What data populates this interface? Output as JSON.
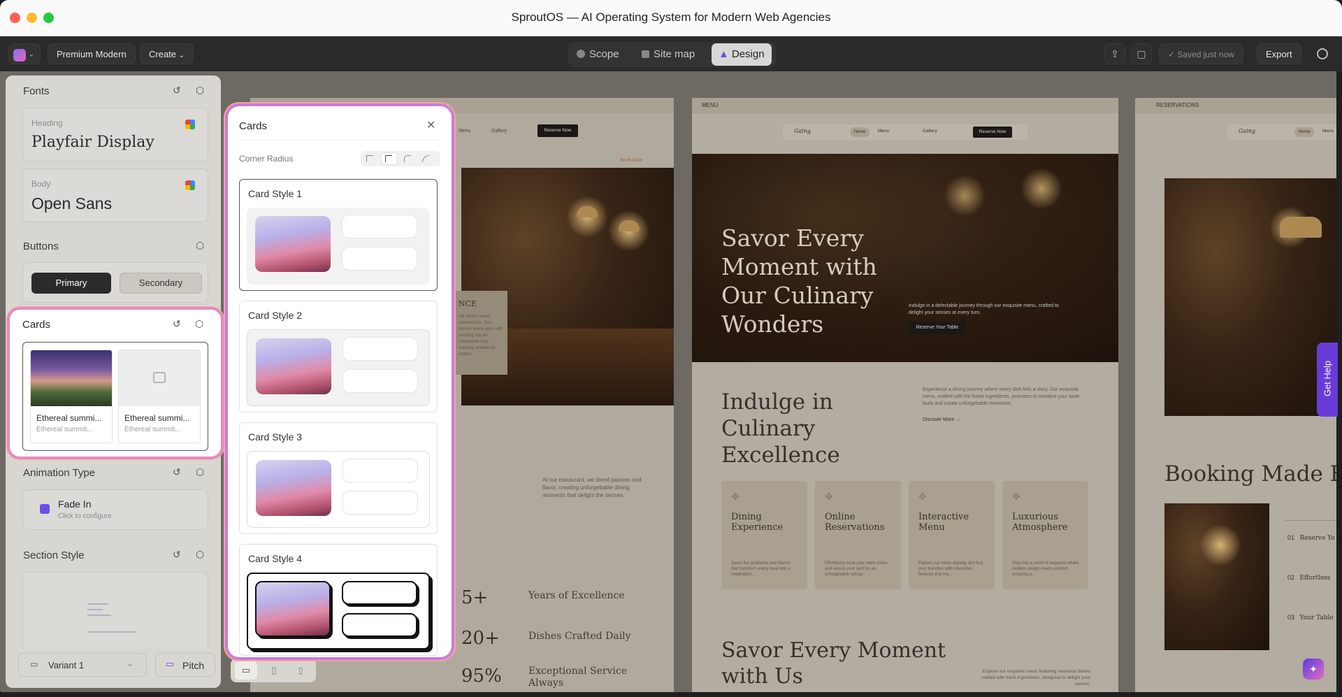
{
  "window": {
    "title": "SproutOS — AI Operating System for Modern Web Agencies"
  },
  "toolbar": {
    "project": "Premium Modern",
    "create": "Create",
    "tabs": {
      "scope": "Scope",
      "sitemap": "Site map",
      "design": "Design"
    },
    "saved": "Saved just now",
    "export": "Export"
  },
  "left": {
    "fonts": {
      "title": "Fonts",
      "heading_label": "Heading",
      "heading_font": "Playfair Display",
      "body_label": "Body",
      "body_font": "Open Sans"
    },
    "buttons": {
      "title": "Buttons",
      "primary": "Primary",
      "secondary": "Secondary"
    },
    "cards": {
      "title": "Cards",
      "card1_title": "Ethereal summi...",
      "card1_sub": "Ethereal summit...",
      "card2_title": "Ethereal summi...",
      "card2_sub": "Ethereal summit..."
    },
    "animation": {
      "title": "Animation Type",
      "name": "Fade In",
      "hint": "Click to configure"
    },
    "section": {
      "title": "Section Style"
    },
    "footer": {
      "variant": "Variant 1",
      "pitch": "Pitch"
    }
  },
  "cards_panel": {
    "title": "Cards",
    "corner_radius": "Corner Radius",
    "styles": [
      "Card Style 1",
      "Card Style 2",
      "Card Style 3",
      "Card Style 4"
    ]
  },
  "preview1": {
    "nav": {
      "menu": "Menu",
      "gallery": "Gallery",
      "reserve": "Reserve Now"
    },
    "book": "Book Now",
    "side_title": "NCE",
    "side_text": "old where every ntersecture. Our cluster worls ates with exciting ing an interactive ious culinary ambiance inctive.",
    "para": "At our restaurant, we blend passion and flavor, creating unforgettable dining moments that delight the senses.",
    "stats": [
      {
        "num": "5+",
        "label": "Years of Excellence"
      },
      {
        "num": "20+",
        "label": "Dishes Crafted Daily"
      },
      {
        "num": "95%",
        "label": "Exceptional Service Always"
      }
    ]
  },
  "preview2": {
    "label": "MENU",
    "nav": {
      "logo": "Gaing",
      "home": "Home",
      "menu": "Menu",
      "gallery": "Gallery",
      "reserve": "Reserve Now"
    },
    "hero_title": "Savor Every Moment with Our Culinary Wonders",
    "hero_text": "Indulge in a delectable journey through our exquisite menu, crafted to delight your senses at every turn.",
    "hero_btn": "Reserve Your Table",
    "section_title": "Indulge in Culinary Excellence",
    "section_text": "Experience a dining journey where every dish tells a story. Our exquisite menu, crafted with the finest ingredients, promises to tantalize your taste buds and create unforgettable memories.",
    "discover": "Discover More",
    "features": [
      {
        "title": "Dining Experience",
        "text": "Savor the ambiance and flavors that transform every meal into a celebration..."
      },
      {
        "title": "Online Reservations",
        "text": "Effortlessly book your table online and secure your spot for an unforgettable culinar..."
      },
      {
        "title": "Interactive Menu",
        "text": "Explore our menu digitally and find your favorites with interactive features that ma..."
      },
      {
        "title": "Luxurious Atmosphere",
        "text": "Step into a world of elegance where modern design meets comfort, ensuring a..."
      }
    ],
    "bottom_title": "Savor Every Moment with Us",
    "bottom_text": "Explore our exquisite menu featuring seasonal dishes crafted with fresh ingredients, designed to delight your senses."
  },
  "preview3": {
    "label": "RESERVATIONS",
    "nav": {
      "logo": "Gaing",
      "home": "Home",
      "menu": "Menu"
    },
    "title": "Booking Made Eas",
    "list": [
      {
        "n": "01",
        "t": "Reserve Yo"
      },
      {
        "n": "02",
        "t": "Effortless"
      },
      {
        "n": "03",
        "t": "Your Table"
      }
    ]
  },
  "help": "Get Help"
}
